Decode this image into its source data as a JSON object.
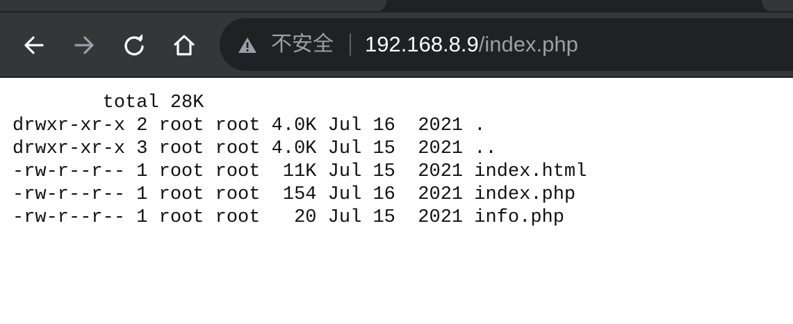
{
  "browser": {
    "security_text": "不安全",
    "url_host": "192.168.8.9",
    "url_path": "/index.php"
  },
  "listing": {
    "total_line": "        total 28K",
    "rows": [
      "drwxr-xr-x 2 root root 4.0K Jul 16  2021 .",
      "drwxr-xr-x 3 root root 4.0K Jul 15  2021 ..",
      "-rw-r--r-- 1 root root  11K Jul 15  2021 index.html",
      "-rw-r--r-- 1 root root  154 Jul 16  2021 index.php",
      "-rw-r--r-- 1 root root   20 Jul 15  2021 info.php"
    ]
  },
  "colors": {
    "toolbar": "#35363a",
    "omnibox": "#202124",
    "icon_active": "#ffffff",
    "icon_disabled": "#9aa0a6"
  }
}
